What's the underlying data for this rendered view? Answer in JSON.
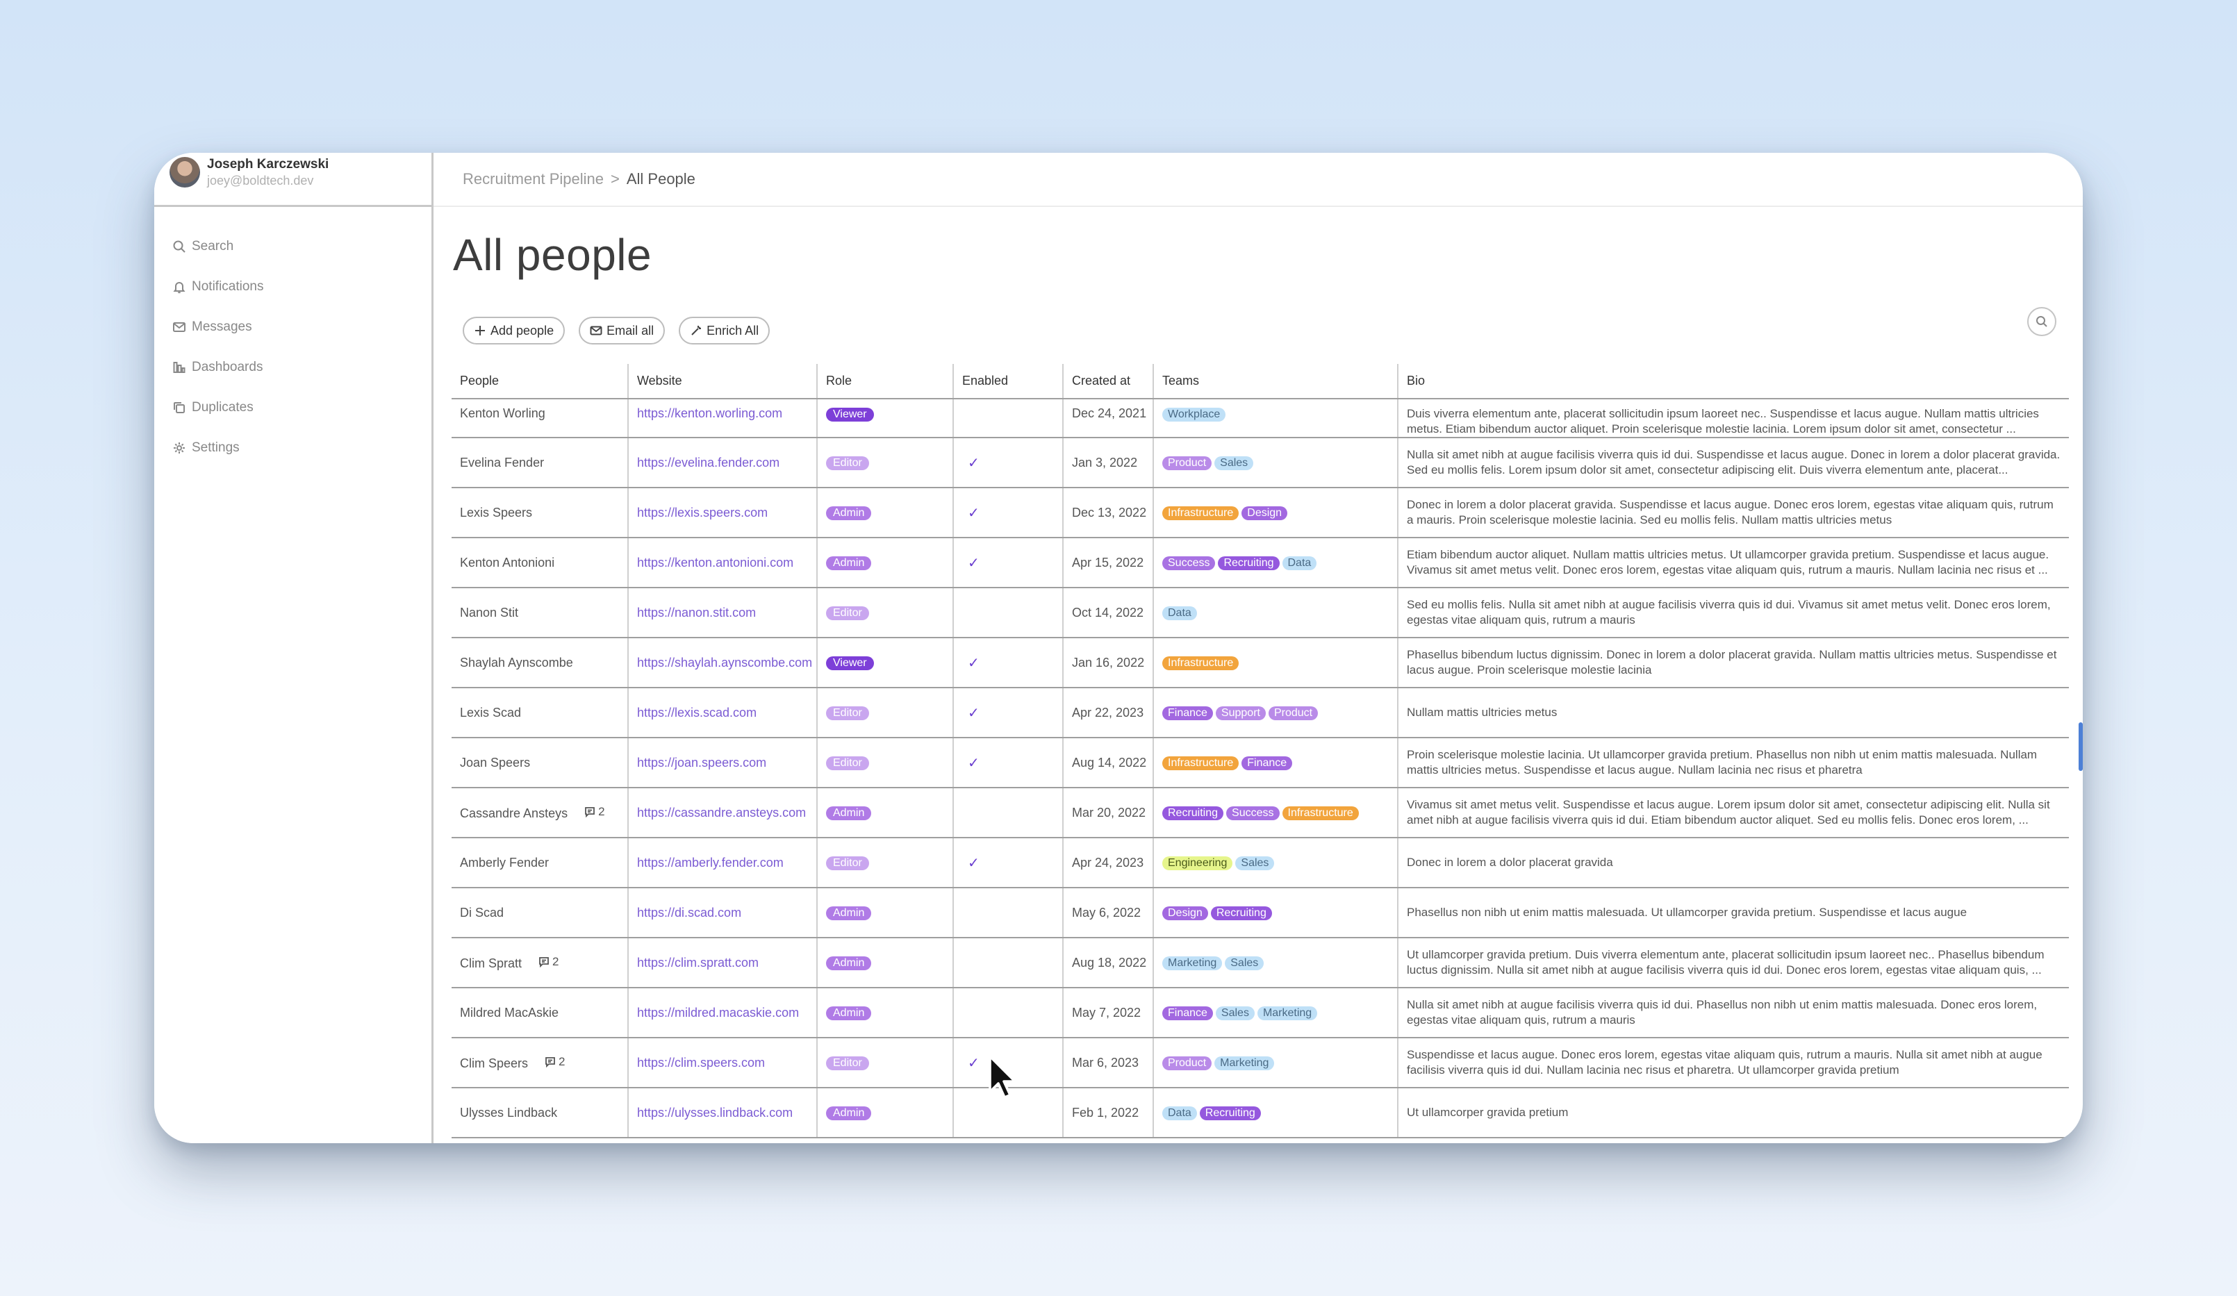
{
  "user": {
    "name": "Joseph Karczewski",
    "email": "joey@boldtech.dev"
  },
  "nav": [
    {
      "label": "Search",
      "icon": "search-icon"
    },
    {
      "label": "Notifications",
      "icon": "bell-icon"
    },
    {
      "label": "Messages",
      "icon": "mail-icon"
    },
    {
      "label": "Dashboards",
      "icon": "chart-icon"
    },
    {
      "label": "Duplicates",
      "icon": "copy-icon"
    },
    {
      "label": "Settings",
      "icon": "gear-icon"
    }
  ],
  "breadcrumb": {
    "parent": "Recruitment Pipeline",
    "separator": ">",
    "current": "All People"
  },
  "page_title": "All people",
  "actions": {
    "add": "Add people",
    "email": "Email all",
    "enrich": "Enrich All"
  },
  "colors": {
    "accent": "#7b5bd3",
    "viewer": "#7d3fd8",
    "admin": "#b07be6",
    "editor": "#c9a6ef"
  },
  "table": {
    "headers": [
      "People",
      "Website",
      "Role",
      "Enabled",
      "Created at",
      "Teams",
      "Bio"
    ],
    "rows": [
      {
        "name": "Kenton Worling",
        "comments": "",
        "website": "https://kenton.worling.com",
        "role": "Viewer",
        "enabled": false,
        "created": "Dec 24, 2021",
        "teams": [
          "Workplace"
        ],
        "bio": "Duis viverra elementum ante, placerat sollicitudin ipsum laoreet nec.. Suspendisse et lacus augue. Nullam mattis ultricies metus. Etiam bibendum auctor aliquet. Proin scelerisque molestie lacinia. Lorem ipsum dolor sit amet, consectetur ..."
      },
      {
        "name": "Evelina Fender",
        "comments": "",
        "website": "https://evelina.fender.com",
        "role": "Editor",
        "enabled": true,
        "created": "Jan 3, 2022",
        "teams": [
          "Product",
          "Sales"
        ],
        "bio": "Nulla sit amet nibh at augue facilisis viverra quis id dui. Suspendisse et lacus augue. Donec in lorem a dolor placerat gravida. Sed eu mollis felis. Lorem ipsum dolor sit amet, consectetur adipiscing elit. Duis viverra elementum ante, placerat..."
      },
      {
        "name": "Lexis Speers",
        "comments": "",
        "website": "https://lexis.speers.com",
        "role": "Admin",
        "enabled": true,
        "created": "Dec 13, 2022",
        "teams": [
          "Infrastructure",
          "Design"
        ],
        "bio": "Donec in lorem a dolor placerat gravida. Suspendisse et lacus augue. Donec eros lorem, egestas vitae aliquam quis, rutrum a mauris. Proin scelerisque molestie lacinia. Sed eu mollis felis. Nullam mattis ultricies metus"
      },
      {
        "name": "Kenton Antonioni",
        "comments": "",
        "website": "https://kenton.antonioni.com",
        "role": "Admin",
        "enabled": true,
        "created": "Apr 15, 2022",
        "teams": [
          "Success",
          "Recruiting",
          "Data"
        ],
        "bio": "Etiam bibendum auctor aliquet. Nullam mattis ultricies metus. Ut ullamcorper gravida pretium. Suspendisse et lacus augue. Vivamus sit amet metus velit. Donec eros lorem, egestas vitae aliquam quis, rutrum a mauris. Nullam lacinia nec risus et ..."
      },
      {
        "name": "Nanon Stit",
        "comments": "",
        "website": "https://nanon.stit.com",
        "role": "Editor",
        "enabled": false,
        "created": "Oct 14, 2022",
        "teams": [
          "Data"
        ],
        "bio": "Sed eu mollis felis. Nulla sit amet nibh at augue facilisis viverra quis id dui. Vivamus sit amet metus velit. Donec eros lorem, egestas vitae aliquam quis, rutrum a mauris"
      },
      {
        "name": "Shaylah Aynscombe",
        "comments": "",
        "website": "https://shaylah.aynscombe.com",
        "role": "Viewer",
        "enabled": true,
        "created": "Jan 16, 2022",
        "teams": [
          "Infrastructure"
        ],
        "bio": "Phasellus bibendum luctus dignissim. Donec in lorem a dolor placerat gravida. Nullam mattis ultricies metus. Suspendisse et lacus augue. Proin scelerisque molestie lacinia"
      },
      {
        "name": "Lexis Scad",
        "comments": "",
        "website": "https://lexis.scad.com",
        "role": "Editor",
        "enabled": true,
        "created": "Apr 22, 2023",
        "teams": [
          "Finance",
          "Support",
          "Product"
        ],
        "bio": "Nullam mattis ultricies metus"
      },
      {
        "name": "Joan Speers",
        "comments": "",
        "website": "https://joan.speers.com",
        "role": "Editor",
        "enabled": true,
        "created": "Aug 14, 2022",
        "teams": [
          "Infrastructure",
          "Finance"
        ],
        "bio": "Proin scelerisque molestie lacinia. Ut ullamcorper gravida pretium. Phasellus non nibh ut enim mattis malesuada. Nullam mattis ultricies metus. Suspendisse et lacus augue. Nullam lacinia nec risus et pharetra"
      },
      {
        "name": "Cassandre Ansteys",
        "comments": "2",
        "website": "https://cassandre.ansteys.com",
        "role": "Admin",
        "enabled": false,
        "created": "Mar 20, 2022",
        "teams": [
          "Recruiting",
          "Success",
          "Infrastructure"
        ],
        "bio": "Vivamus sit amet metus velit. Suspendisse et lacus augue. Lorem ipsum dolor sit amet, consectetur adipiscing elit. Nulla sit amet nibh at augue facilisis viverra quis id dui. Etiam bibendum auctor aliquet. Sed eu mollis felis. Donec eros lorem, ..."
      },
      {
        "name": "Amberly Fender",
        "comments": "",
        "website": "https://amberly.fender.com",
        "role": "Editor",
        "enabled": true,
        "created": "Apr 24, 2023",
        "teams": [
          "Engineering",
          "Sales"
        ],
        "bio": "Donec in lorem a dolor placerat gravida"
      },
      {
        "name": "Di Scad",
        "comments": "",
        "website": "https://di.scad.com",
        "role": "Admin",
        "enabled": false,
        "created": "May 6, 2022",
        "teams": [
          "Design",
          "Recruiting"
        ],
        "bio": "Phasellus non nibh ut enim mattis malesuada. Ut ullamcorper gravida pretium. Suspendisse et lacus augue"
      },
      {
        "name": "Clim Spratt",
        "comments": "2",
        "website": "https://clim.spratt.com",
        "role": "Admin",
        "enabled": false,
        "created": "Aug 18, 2022",
        "teams": [
          "Marketing",
          "Sales"
        ],
        "bio": "Ut ullamcorper gravida pretium. Duis viverra elementum ante, placerat sollicitudin ipsum laoreet nec.. Phasellus bibendum luctus dignissim. Nulla sit amet nibh at augue facilisis viverra quis id dui. Donec eros lorem, egestas vitae aliquam quis, ..."
      },
      {
        "name": "Mildred MacAskie",
        "comments": "",
        "website": "https://mildred.macaskie.com",
        "role": "Admin",
        "enabled": false,
        "created": "May 7, 2022",
        "teams": [
          "Finance",
          "Sales",
          "Marketing"
        ],
        "bio": "Nulla sit amet nibh at augue facilisis viverra quis id dui. Phasellus non nibh ut enim mattis malesuada. Donec eros lorem, egestas vitae aliquam quis, rutrum a mauris"
      },
      {
        "name": "Clim Speers",
        "comments": "2",
        "website": "https://clim.speers.com",
        "role": "Editor",
        "enabled": true,
        "created": "Mar 6, 2023",
        "teams": [
          "Product",
          "Marketing"
        ],
        "bio": "Suspendisse et lacus augue. Donec eros lorem, egestas vitae aliquam quis, rutrum a mauris. Nulla sit amet nibh at augue facilisis viverra quis id dui. Nullam lacinia nec risus et pharetra. Ut ullamcorper gravida pretium"
      },
      {
        "name": "Ulysses Lindback",
        "comments": "",
        "website": "https://ulysses.lindback.com",
        "role": "Admin",
        "enabled": false,
        "created": "Feb 1, 2022",
        "teams": [
          "Data",
          "Recruiting"
        ],
        "bio": "Ut ullamcorper gravida pretium"
      }
    ]
  },
  "team_colors": {
    "Workplace": [
      "#bfe0f7",
      "#4a6a85"
    ],
    "Product": [
      "#b98be8",
      "#ffffff"
    ],
    "Sales": [
      "#bfe0f7",
      "#4a6a85"
    ],
    "Infrastructure": [
      "#f2a43c",
      "#ffffff"
    ],
    "Design": [
      "#a268e0",
      "#ffffff"
    ],
    "Success": [
      "#a872e3",
      "#ffffff"
    ],
    "Recruiting": [
      "#9558de",
      "#ffffff"
    ],
    "Data": [
      "#bfe0f7",
      "#4a6a85"
    ],
    "Finance": [
      "#a268e0",
      "#ffffff"
    ],
    "Support": [
      "#b98be8",
      "#ffffff"
    ],
    "Engineering": [
      "#e6f58c",
      "#4a5a1a"
    ],
    "Marketing": [
      "#bfe0f7",
      "#4a6a85"
    ]
  }
}
